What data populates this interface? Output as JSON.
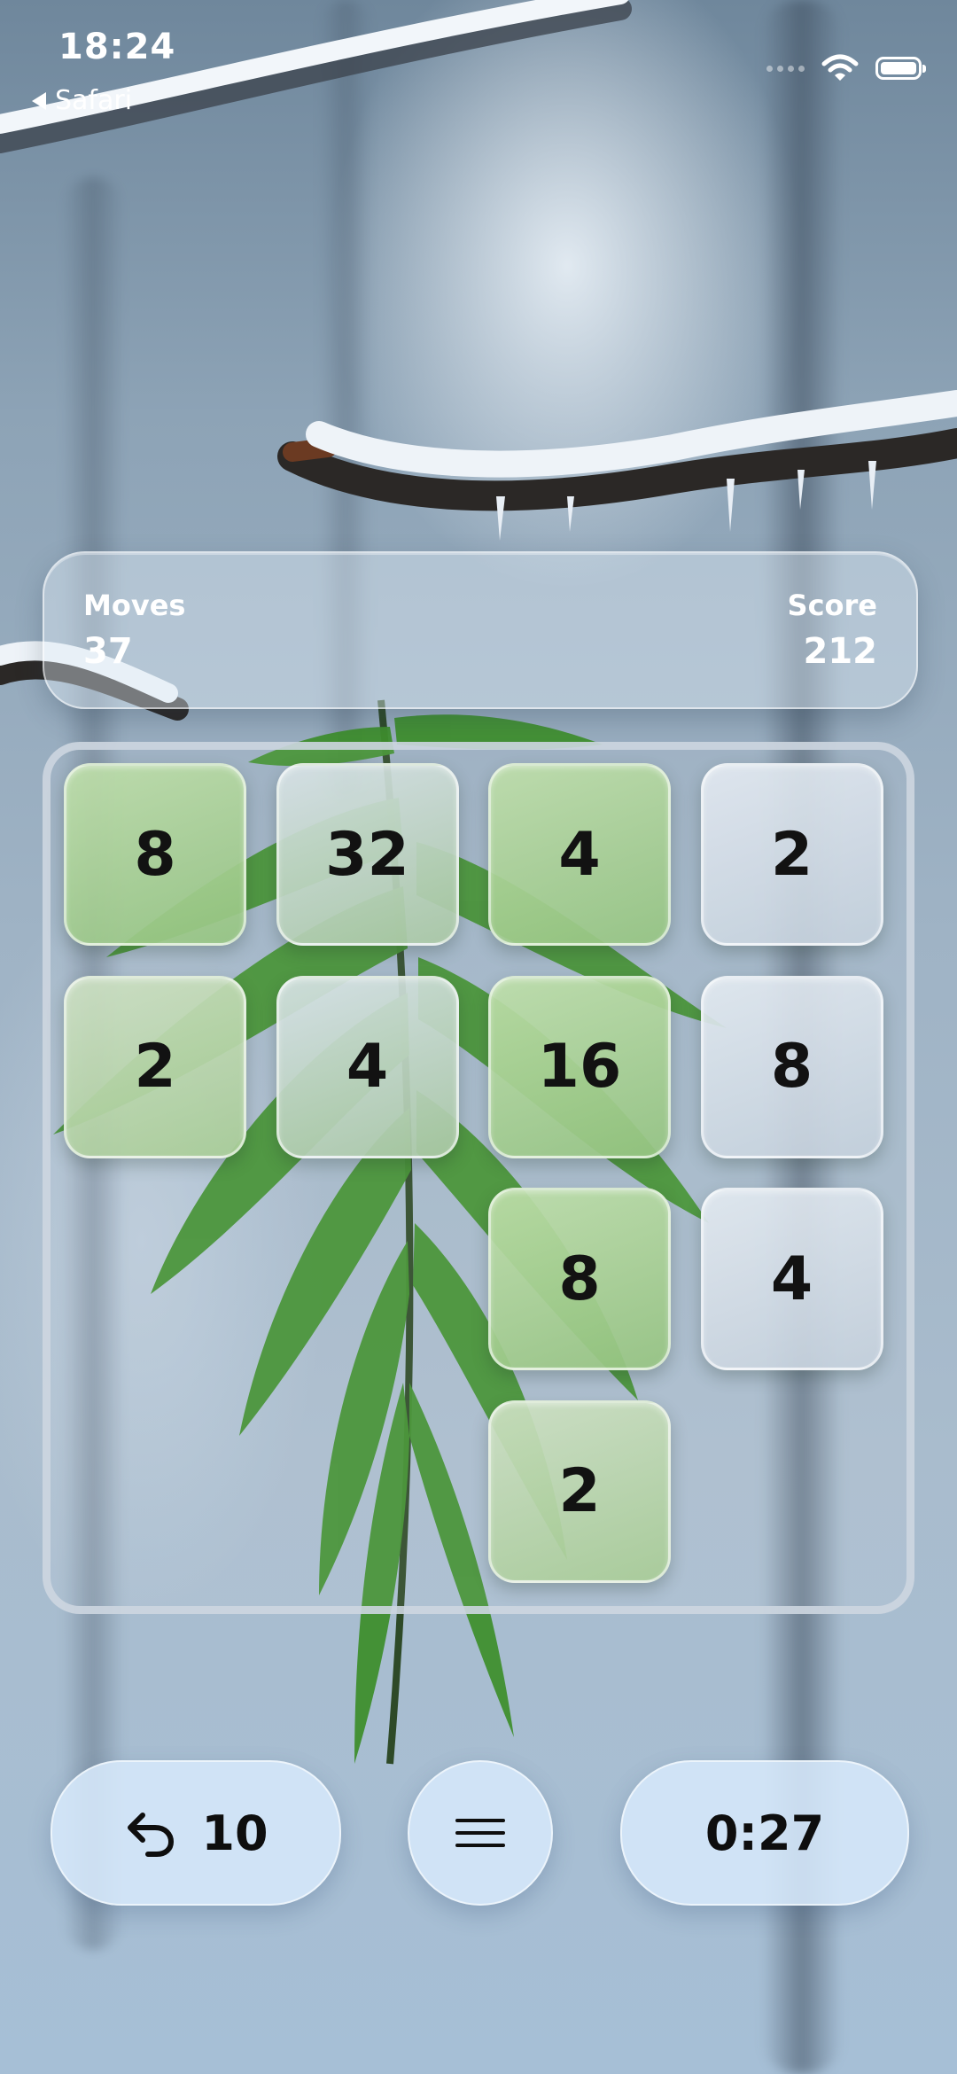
{
  "status_bar": {
    "time": "18:24",
    "back_app": "Safari"
  },
  "stats": {
    "moves_label": "Moves",
    "moves_value": "37",
    "score_label": "Score",
    "score_value": "212"
  },
  "board": {
    "size": 4,
    "tiles": [
      {
        "row": 0,
        "col": 0,
        "value": "8",
        "tint": "green"
      },
      {
        "row": 0,
        "col": 1,
        "value": "32",
        "tint": "mixed"
      },
      {
        "row": 0,
        "col": 2,
        "value": "4",
        "tint": "green"
      },
      {
        "row": 0,
        "col": 3,
        "value": "2",
        "tint": "grey"
      },
      {
        "row": 1,
        "col": 0,
        "value": "2",
        "tint": "greenpale"
      },
      {
        "row": 1,
        "col": 1,
        "value": "4",
        "tint": "mixed"
      },
      {
        "row": 1,
        "col": 2,
        "value": "16",
        "tint": "green"
      },
      {
        "row": 1,
        "col": 3,
        "value": "8",
        "tint": "grey"
      },
      {
        "row": 2,
        "col": 2,
        "value": "8",
        "tint": "green"
      },
      {
        "row": 2,
        "col": 3,
        "value": "4",
        "tint": "grey"
      },
      {
        "row": 3,
        "col": 2,
        "value": "2",
        "tint": "greenpale"
      }
    ]
  },
  "controls": {
    "undo_count": "10",
    "undo_icon": "undo-arrow-icon",
    "menu_icon": "hamburger-menu-icon",
    "timer": "0:27"
  },
  "colors": {
    "pill_background": "#d6e8fa",
    "tile_text": "#121212",
    "board_border": "#cdd6e0"
  }
}
